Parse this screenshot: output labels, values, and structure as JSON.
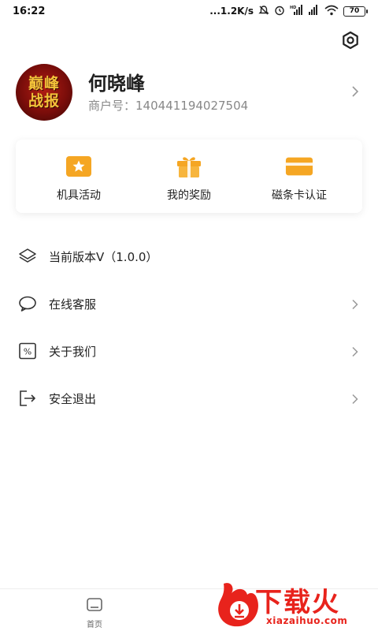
{
  "status_bar": {
    "time": "16:22",
    "network_speed": "...1.2K/s",
    "battery": "70"
  },
  "profile": {
    "avatar_text_line1": "巅峰",
    "avatar_text_line2": "战报",
    "name": "何晓峰",
    "merchant_label": "商户号：",
    "merchant_id": "140441194027504"
  },
  "quick_actions": [
    {
      "label": "机具活动",
      "icon": "star-card-icon"
    },
    {
      "label": "我的奖励",
      "icon": "gift-icon"
    },
    {
      "label": "磁条卡认证",
      "icon": "bank-card-icon"
    }
  ],
  "menu": [
    {
      "label": "当前版本V（1.0.0）",
      "icon": "layers-icon",
      "has_chevron": false
    },
    {
      "label": "在线客服",
      "icon": "chat-bubble-icon",
      "has_chevron": true
    },
    {
      "label": "关于我们",
      "icon": "percent-icon",
      "has_chevron": true
    },
    {
      "label": "安全退出",
      "icon": "logout-icon",
      "has_chevron": true
    }
  ],
  "bottom_nav": {
    "home_label": "首页"
  },
  "watermark": {
    "text": "下载火",
    "site": "xiazaihuo.com"
  },
  "colors": {
    "accent_orange": "#f5a623",
    "watermark_red": "#e8231c"
  }
}
